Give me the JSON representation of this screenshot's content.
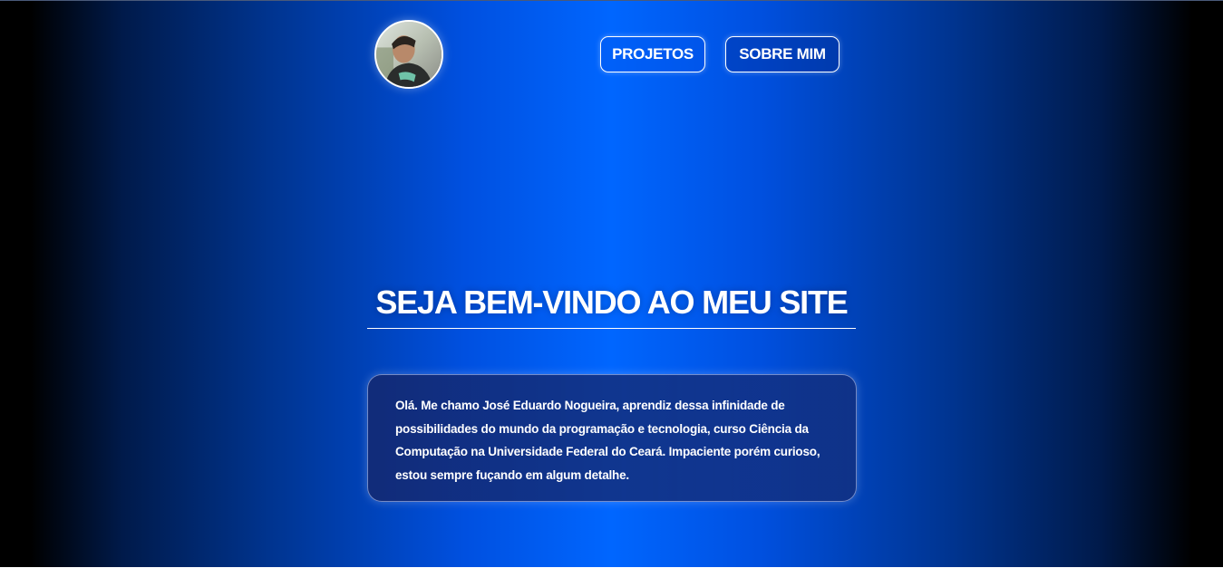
{
  "header": {
    "avatar_alt": "Foto de perfil",
    "nav": {
      "projects_label": "PROJETOS",
      "about_label": "SOBRE MIM"
    }
  },
  "hero": {
    "title": "SEJA BEM-VINDO AO MEU SITE"
  },
  "about": {
    "text": "Olá. Me chamo José Eduardo Nogueira, aprendiz dessa infinidade de possibilidades do mundo da programação e tecnologia, curso Ciência da Computação na Universidade Federal do Ceará. Impaciente porém curioso, estou sempre fuçando em algum detalhe."
  },
  "colors": {
    "center": "#0066ff",
    "edge": "#000000",
    "text": "#ffffff"
  }
}
